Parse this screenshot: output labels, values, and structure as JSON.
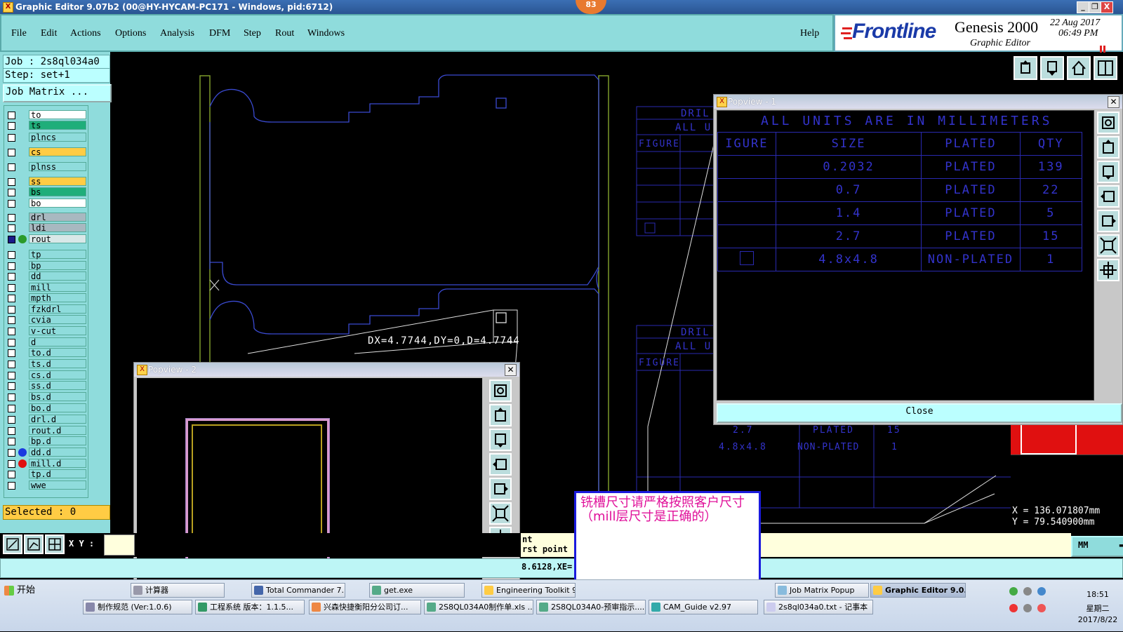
{
  "window": {
    "title": "Graphic Editor 9.07b2 (00@HY-HYCAM-PC171 - Windows, pid:6712)",
    "badge": "83",
    "minimize": "_",
    "restore": "❐",
    "close": "X"
  },
  "menu": {
    "file": "File",
    "edit": "Edit",
    "actions": "Actions",
    "options": "Options",
    "analysis": "Analysis",
    "dfm": "DFM",
    "step": "Step",
    "rout": "Rout",
    "windows": "Windows",
    "help": "Help"
  },
  "brand": {
    "logo": "Frontline",
    "product": "Genesis 2000",
    "subtitle": "Graphic Editor",
    "date": "22 Aug 2017",
    "time": "06:49 PM"
  },
  "left": {
    "job": "Job : 2s8ql034a0",
    "step": "Step: set+1",
    "job_matrix": "Job Matrix ...",
    "selected": "Selected : 0",
    "xy_label": "X Y :",
    "xy_value": ""
  },
  "layers": [
    {
      "name": "to",
      "color": "#ffffff"
    },
    {
      "name": "ts",
      "color": "#1fae7a"
    },
    {
      "name": "plncs",
      "color": "#8fdcdc"
    },
    {
      "name": "cs",
      "color": "#ffcc44"
    },
    {
      "name": "plnss",
      "color": "#8fdcdc"
    },
    {
      "name": "ss",
      "color": "#ffcc44"
    },
    {
      "name": "bs",
      "color": "#1fae7a"
    },
    {
      "name": "bo",
      "color": "#ffffff"
    },
    {
      "name": "drl",
      "color": "#a8b8c0"
    },
    {
      "name": "ldi",
      "color": "#a8b8c0"
    },
    {
      "name": "rout",
      "color": "#d8e8e8"
    },
    {
      "name": "tp",
      "color": "#8fdcdc"
    },
    {
      "name": "bp",
      "color": "#8fdcdc"
    },
    {
      "name": "dd",
      "color": "#8fdcdc"
    },
    {
      "name": "mill",
      "color": "#8fdcdc"
    },
    {
      "name": "mpth",
      "color": "#8fdcdc"
    },
    {
      "name": "fzkdrl",
      "color": "#8fdcdc"
    },
    {
      "name": "cvia",
      "color": "#8fdcdc"
    },
    {
      "name": "v-cut",
      "color": "#8fdcdc"
    },
    {
      "name": "d",
      "color": "#8fdcdc"
    },
    {
      "name": "to.d",
      "color": "#8fdcdc"
    },
    {
      "name": "ts.d",
      "color": "#8fdcdc"
    },
    {
      "name": "cs.d",
      "color": "#8fdcdc"
    },
    {
      "name": "ss.d",
      "color": "#8fdcdc"
    },
    {
      "name": "bs.d",
      "color": "#8fdcdc"
    },
    {
      "name": "bo.d",
      "color": "#8fdcdc"
    },
    {
      "name": "drl.d",
      "color": "#8fdcdc"
    },
    {
      "name": "rout.d",
      "color": "#8fdcdc"
    },
    {
      "name": "bp.d",
      "color": "#8fdcdc"
    },
    {
      "name": "dd.d",
      "color": "#8fdcdc"
    },
    {
      "name": "mill.d",
      "color": "#8fdcdc"
    },
    {
      "name": "tp.d",
      "color": "#8fdcdc"
    },
    {
      "name": "wwe",
      "color": "#8fdcdc"
    }
  ],
  "canvas": {
    "measure": "DX=4.7744,DY=0,D=4.7744",
    "drill_header1": "DRIL",
    "drill_header2": "ALL U",
    "figure_label": "FIGURE",
    "bg_row1_size": "2.7",
    "bg_row1_plated": "PLATED",
    "bg_row1_qty": "15",
    "bg_row2_size": "4.8x4.8",
    "bg_row2_plated": "NON-PLATED",
    "bg_row2_qty": "1",
    "coord_x": "X = 136.071807mm",
    "coord_y": "Y = 79.540900mm",
    "hint1": "nt",
    "hint2": "rst point",
    "coord_partial": "8.6128,XE="
  },
  "popview1": {
    "title": "Popview - 1",
    "units": "ALL UNITS ARE IN MILLIMETERS",
    "headers": [
      "IGURE",
      "SIZE",
      "PLATED",
      "QTY"
    ],
    "rows": [
      [
        "",
        "0.2032",
        "PLATED",
        "139"
      ],
      [
        "",
        "0.7",
        "PLATED",
        "22"
      ],
      [
        "",
        "1.4",
        "PLATED",
        "5"
      ],
      [
        "",
        "2.7",
        "PLATED",
        "15"
      ],
      [
        "",
        "4.8x4.8",
        "NON-PLATED",
        "1"
      ]
    ],
    "close_label": "Close"
  },
  "popview2": {
    "title": "Popview - 2"
  },
  "note": "铣槽尺寸请严格按照客户尺寸（mill层尺寸是正确的）",
  "unit_select": "MM",
  "taskbar": {
    "start": "开始",
    "row1": [
      "计算器",
      "Total Commander 7....",
      "get.exe",
      "Engineering Toolkit 9....",
      "Job Matrix Popup",
      "Graphic Editor 9.0..."
    ],
    "row2": [
      "制作规范 (Ver:1.0.6)",
      "工程系统  版本：1.1.5...",
      "兴森快捷衡阳分公司订...",
      "2S8QL034A0制作单.xls ...",
      "2S8QL034A0-预审指示....",
      "CAM_Guide v2.97",
      "2s8ql034a0.txt - 记事本"
    ],
    "clock_time": "18:51",
    "clock_day": "星期二",
    "clock_date": "2017/8/22"
  }
}
